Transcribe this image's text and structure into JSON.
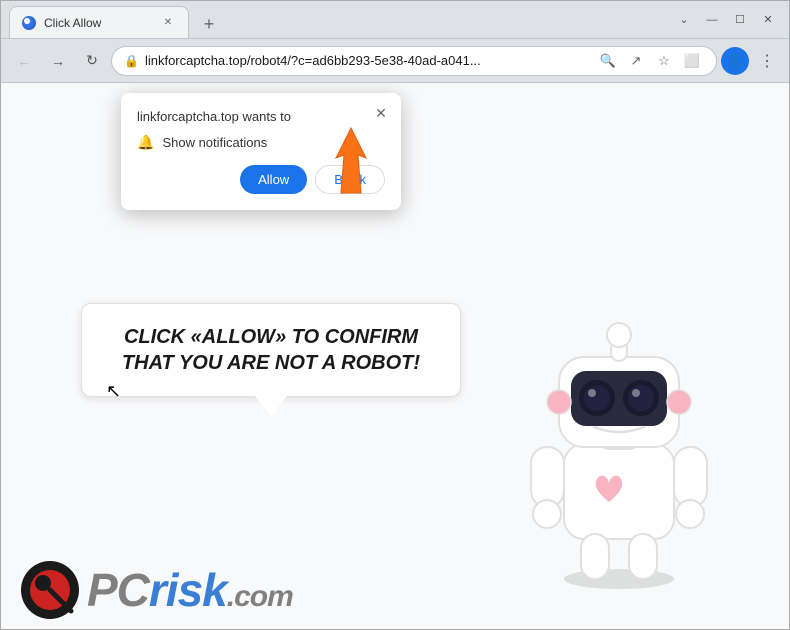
{
  "browser": {
    "tab": {
      "title": "Click Allow",
      "favicon_alt": "browser-favicon"
    },
    "address": {
      "url": "linkforcaptcha.top/robot4/?c=ad6bb293-5e38-40ad-a041...",
      "lock_icon": "🔒"
    },
    "window_controls": {
      "minimize": "—",
      "maximize": "☐",
      "close": "✕"
    }
  },
  "notification_popup": {
    "header": "linkforcaptcha.top wants to",
    "notification_label": "Show notifications",
    "allow_btn": "Allow",
    "block_btn": "Block",
    "close_icon": "✕"
  },
  "speech_bubble": {
    "text": "CLICK «ALLOW» TO CONFIRM THAT YOU ARE NOT A ROBOT!"
  },
  "logo": {
    "pc": "PC",
    "risk": "risk",
    "com": ".com"
  },
  "nav": {
    "back": "←",
    "forward": "→",
    "reload": "↻",
    "new_tab": "+"
  }
}
